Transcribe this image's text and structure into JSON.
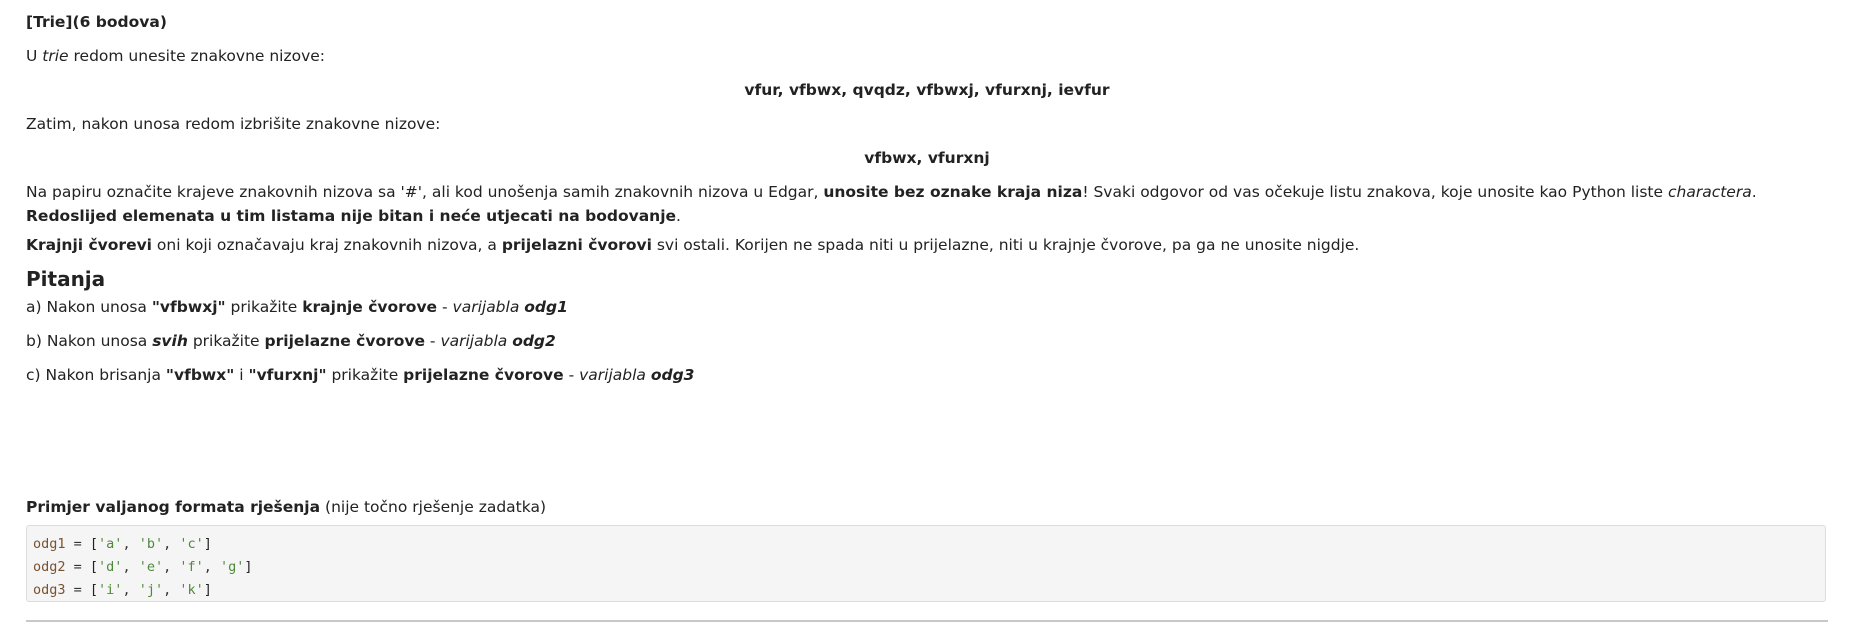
{
  "header": {
    "title": "[Trie](6 bodova)"
  },
  "intro": {
    "line1_prefix": "U ",
    "line1_italic": "trie",
    "line1_suffix": " redom unesite znakovne nizove:",
    "insert_strings": "vfur, vfbwx, qvqdz, vfbwxj, vfurxnj, ievfur",
    "line2": "Zatim, nakon unosa redom izbrišite znakovne nizove:",
    "delete_strings": "vfbwx, vfurxnj"
  },
  "instructions": {
    "part1": "Na papiru označite krajeve znakovnih nizova sa '#', ali kod unošenja samih znakovnih nizova u Edgar, ",
    "part1_bold": "unosite bez oznake kraja niza",
    "part2": "! Svaki odgovor od vas očekuje listu znakova, koje unosite kao Python liste ",
    "part2_italic": "charactera",
    "part3": ". ",
    "part3_bold": "Redoslijed elemenata u tim listama nije bitan i neće utjecati na bodovanje",
    "part4": "."
  },
  "definitions": {
    "bold1": "Krajnji čvorevi",
    "text1": " oni koji označavaju kraj znakovnih nizova, a ",
    "bold2": "prijelazni čvorovi",
    "text2": " svi ostali. Korijen ne spada niti u prijelazne, niti u krajnje čvorove, pa ga ne unosite nigdje."
  },
  "questions": {
    "heading": "Pitanja",
    "a": {
      "prefix": "a) Nakon unosa ",
      "string": "\"vfbwxj\"",
      "mid": " prikažite ",
      "target": "krajnje čvorove",
      "dash": " - ",
      "var_label": "varijabla ",
      "var_name": "odg1"
    },
    "b": {
      "prefix": "b) Nakon unosa ",
      "string": "svih",
      "mid": " prikažite ",
      "target": "prijelazne čvorove",
      "dash": " - ",
      "var_label": "varijabla ",
      "var_name": "odg2"
    },
    "c": {
      "prefix": "c) Nakon brisanja ",
      "string1": "\"vfbwx\"",
      "and": " i ",
      "string2": "\"vfurxnj\"",
      "mid": " prikažite ",
      "target": "prijelazne čvorove",
      "dash": " - ",
      "var_label": "varijabla ",
      "var_name": "odg3"
    }
  },
  "example": {
    "label_bold": "Primjer valjanog formata rješenja",
    "label_rest": " (nije točno rješenje zadatka)",
    "code": [
      {
        "var": "odg1",
        "op": " = ",
        "open": "[",
        "items": [
          "'a'",
          "'b'",
          "'c'"
        ],
        "close": "]"
      },
      {
        "var": "odg2",
        "op": " = ",
        "open": "[",
        "items": [
          "'d'",
          "'e'",
          "'f'",
          "'g'"
        ],
        "close": "]"
      },
      {
        "var": "odg3",
        "op": " = ",
        "open": "[",
        "items": [
          "'i'",
          "'j'",
          "'k'"
        ],
        "close": "]"
      }
    ],
    "separator": ", "
  },
  "colors": {
    "code_var": "#7a5230",
    "code_string": "#4e8a3a",
    "code_background": "#f5f5f5"
  }
}
